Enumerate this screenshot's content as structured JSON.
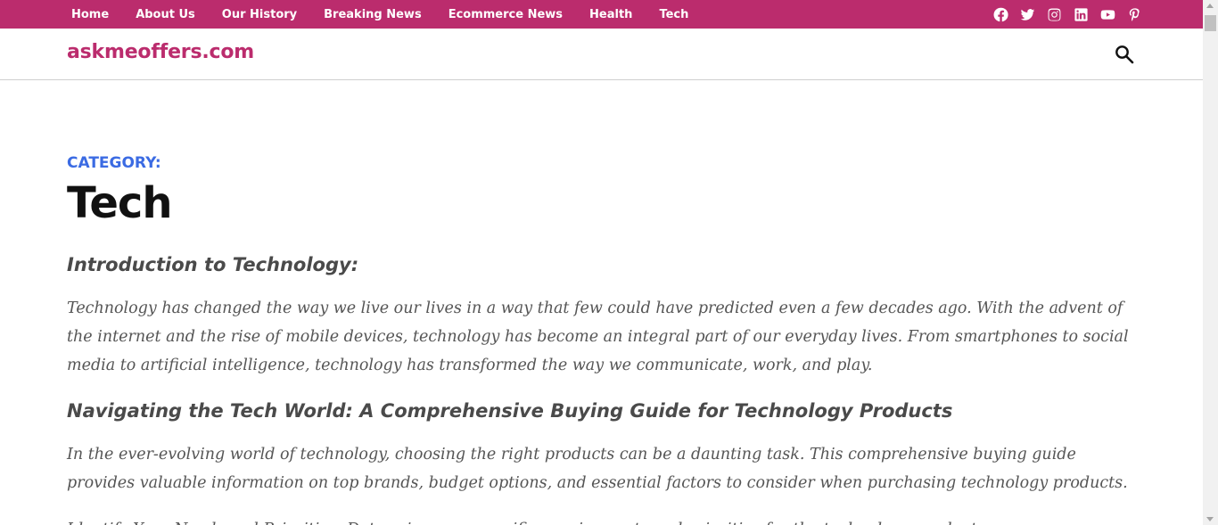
{
  "nav": {
    "items": [
      {
        "label": "Home"
      },
      {
        "label": "About Us"
      },
      {
        "label": "Our History"
      },
      {
        "label": "Breaking News"
      },
      {
        "label": "Ecommerce News"
      },
      {
        "label": "Health"
      },
      {
        "label": "Tech"
      }
    ]
  },
  "social": [
    "facebook-icon",
    "twitter-icon",
    "instagram-icon",
    "linkedin-icon",
    "youtube-icon",
    "pinterest-icon"
  ],
  "site": {
    "title": "askmeoffers.com"
  },
  "category": {
    "label": "Category:",
    "title": "Tech"
  },
  "content": {
    "intro_heading": "Introduction to Technology:",
    "intro_text": "Technology has changed the way we live our lives in a way that few could have predicted even a few decades ago. With the advent of the internet and the rise of mobile devices, technology has become an integral part of our everyday lives. From smartphones to social media to artificial intelligence, technology has transformed the way we communicate, work, and play.",
    "guide_heading": "Navigating the Tech World: A Comprehensive Buying Guide for Technology Products",
    "guide_text": "In the ever-evolving world of technology, choosing the right products can be a daunting task. This comprehensive buying guide provides valuable information on top brands, budget options, and essential factors to consider when purchasing technology products.",
    "partial_text": "Identify Your Needs and Priorities: Determine your specific requirements and priorities for the technology product"
  },
  "colors": {
    "brand": "#bb2c6d",
    "category": "#3b6be3"
  }
}
